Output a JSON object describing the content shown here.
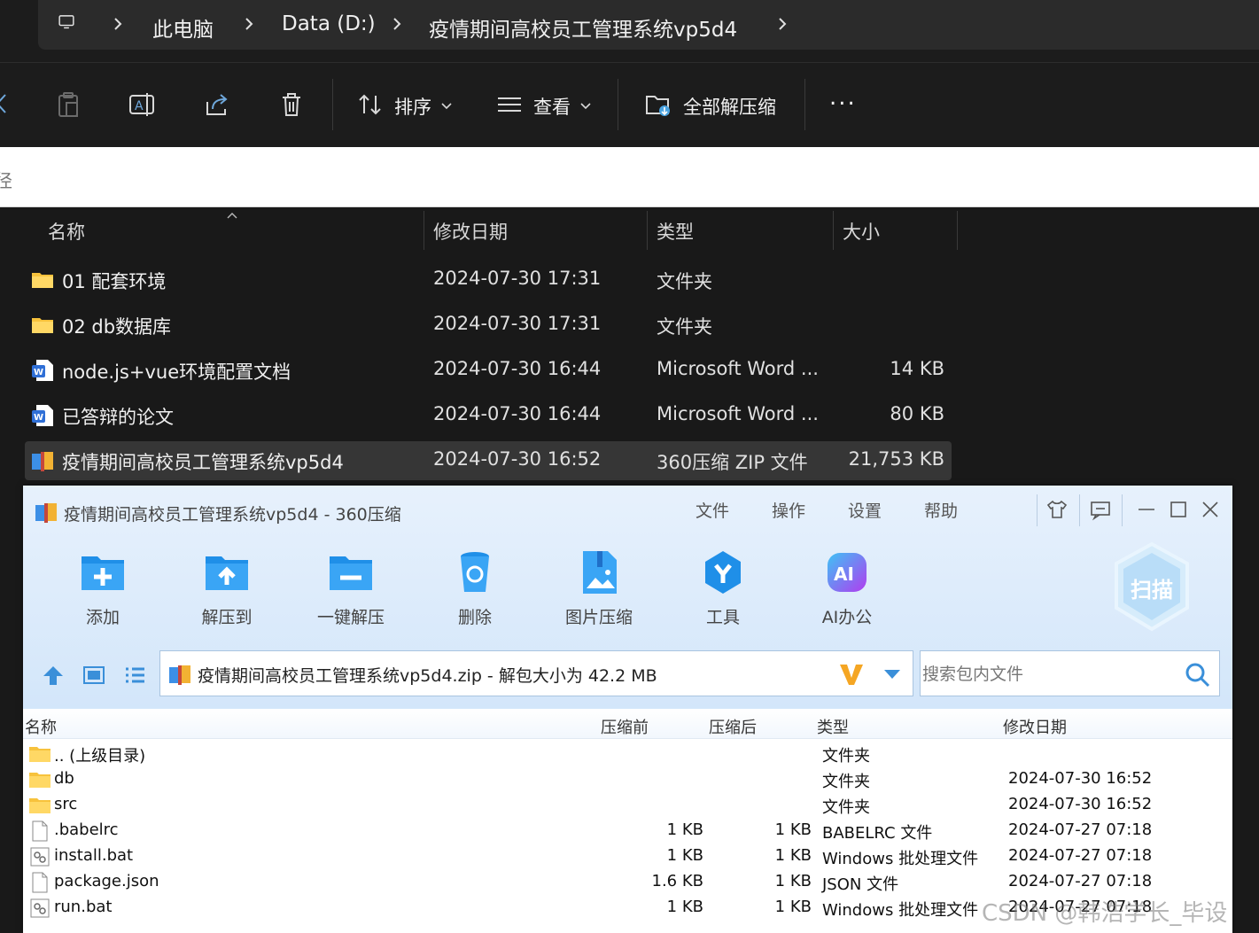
{
  "explorer": {
    "breadcrumb": {
      "root_icon": "monitor-icon",
      "items": [
        "此电脑",
        "Data (D:)",
        "疫情期间高校员工管理系统vp5d4"
      ]
    },
    "toolbar": {
      "icons": [
        "cut-icon",
        "paste-icon",
        "rename-icon",
        "share-icon",
        "delete-icon"
      ],
      "sort_label": "排序",
      "view_label": "查看",
      "extract_all_label": "全部解压缩",
      "more_label": "..."
    },
    "path_hint": "径",
    "columns": {
      "name": "名称",
      "modified": "修改日期",
      "type": "类型",
      "size": "大小"
    },
    "files": [
      {
        "icon": "folder-icon",
        "name": "01 配套环境",
        "modified": "2024-07-30 17:31",
        "type": "文件夹",
        "size": ""
      },
      {
        "icon": "folder-icon",
        "name": "02 db数据库",
        "modified": "2024-07-30 17:31",
        "type": "文件夹",
        "size": ""
      },
      {
        "icon": "word-doc-icon",
        "name": "node.js+vue环境配置文档",
        "modified": "2024-07-30 16:44",
        "type": "Microsoft Word ...",
        "size": "14 KB"
      },
      {
        "icon": "word-doc-icon",
        "name": "已答辩的论文",
        "modified": "2024-07-30 16:44",
        "type": "Microsoft Word ...",
        "size": "80 KB"
      },
      {
        "icon": "zip-archive-icon",
        "name": "疫情期间高校员工管理系统vp5d4",
        "modified": "2024-07-30 16:52",
        "type": "360压缩 ZIP 文件",
        "size": "21,753 KB",
        "selected": true
      }
    ]
  },
  "zip_window": {
    "title": "疫情期间高校员工管理系统vp5d4 - 360压缩",
    "menu": [
      "文件",
      "操作",
      "设置",
      "帮助"
    ],
    "tools": [
      {
        "label": "添加",
        "icon": "add-icon"
      },
      {
        "label": "解压到",
        "icon": "extract-to-icon"
      },
      {
        "label": "一键解压",
        "icon": "one-click-extract-icon"
      },
      {
        "label": "删除",
        "icon": "recycle-bin-icon"
      },
      {
        "label": "图片压缩",
        "icon": "image-compress-icon"
      },
      {
        "label": "工具",
        "icon": "tools-icon"
      },
      {
        "label": "AI办公",
        "icon": "ai-office-icon"
      }
    ],
    "scan_label": "扫描",
    "path_text": "疫情期间高校员工管理系统vp5d4.zip - 解包大小为 42.2 MB",
    "search_placeholder": "搜索包内文件",
    "columns": {
      "name": "名称",
      "before": "压缩前",
      "after": "压缩后",
      "type": "类型",
      "modified": "修改日期"
    },
    "entries": [
      {
        "icon": "folder-icon",
        "name": ".. (上级目录)",
        "before": "",
        "after": "",
        "type": "文件夹",
        "modified": ""
      },
      {
        "icon": "folder-icon",
        "name": "db",
        "before": "",
        "after": "",
        "type": "文件夹",
        "modified": "2024-07-30 16:52"
      },
      {
        "icon": "folder-icon",
        "name": "src",
        "before": "",
        "after": "",
        "type": "文件夹",
        "modified": "2024-07-30 16:52"
      },
      {
        "icon": "blank-file-icon",
        "name": ".babelrc",
        "before": "1 KB",
        "after": "1 KB",
        "type": "BABELRC 文件",
        "modified": "2024-07-27 07:18"
      },
      {
        "icon": "batch-file-icon",
        "name": "install.bat",
        "before": "1 KB",
        "after": "1 KB",
        "type": "Windows 批处理文件",
        "modified": "2024-07-27 07:18"
      },
      {
        "icon": "blank-file-icon",
        "name": "package.json",
        "before": "1.6 KB",
        "after": "1 KB",
        "type": "JSON 文件",
        "modified": "2024-07-27 07:18"
      },
      {
        "icon": "batch-file-icon",
        "name": "run.bat",
        "before": "1 KB",
        "after": "1 KB",
        "type": "Windows 批处理文件",
        "modified": "2024-07-27 07:18"
      }
    ]
  },
  "watermark": "CSDN @韩浩学长_毕设"
}
